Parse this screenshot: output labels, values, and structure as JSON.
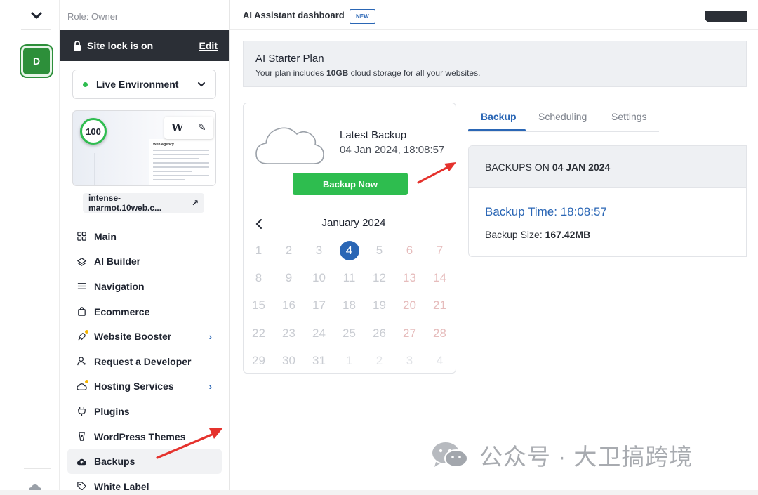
{
  "rail": {
    "avatar_letter": "D"
  },
  "sidebar": {
    "role": "Role: Owner",
    "site_lock": {
      "label": "Site lock is on",
      "edit": "Edit"
    },
    "environment": "Live Environment",
    "preview": {
      "score": "100",
      "site_heading": "Web Agency",
      "wp_glyph": "W",
      "edit_glyph": "✎"
    },
    "domain": {
      "label": "intense-marmot.10web.c...",
      "open_glyph": "↗"
    },
    "items": [
      {
        "label": "Main",
        "icon": "grid-icon",
        "more": ""
      },
      {
        "label": "AI Builder",
        "icon": "layers-icon",
        "more": ""
      },
      {
        "label": "Navigation",
        "icon": "menu-icon",
        "more": ""
      },
      {
        "label": "Ecommerce",
        "icon": "shopping-bag-icon",
        "more": ""
      },
      {
        "label": "Website Booster",
        "icon": "rocket-icon",
        "more": "›"
      },
      {
        "label": "Request a Developer",
        "icon": "developer-icon",
        "more": ""
      },
      {
        "label": "Hosting Services",
        "icon": "cloud-outline-icon",
        "more": "›"
      },
      {
        "label": "Plugins",
        "icon": "plug-icon",
        "more": ""
      },
      {
        "label": "WordPress Themes",
        "icon": "theme-icon",
        "more": ""
      },
      {
        "label": "Backups",
        "icon": "cloud-upload-icon",
        "more": ""
      },
      {
        "label": "White Label",
        "icon": "tag-icon",
        "more": ""
      }
    ]
  },
  "topbar": {
    "title": "AI Assistant dashboard",
    "new_tag": "NEW"
  },
  "plan": {
    "title": "AI Starter Plan",
    "desc_prefix": "Your plan includes ",
    "desc_bold": "10GB",
    "desc_suffix": " cloud storage for all your websites."
  },
  "backup_card": {
    "latest_label": "Latest Backup",
    "latest_date": "04 Jan 2024, 18:08:57",
    "backup_now": "Backup Now",
    "calendar": {
      "month": "January 2024",
      "prev_glyph": "<",
      "selected": "4",
      "weeks": [
        [
          "1",
          "2",
          "3",
          "4",
          "5",
          "6",
          "7"
        ],
        [
          "8",
          "9",
          "10",
          "11",
          "12",
          "13",
          "14"
        ],
        [
          "15",
          "16",
          "17",
          "18",
          "19",
          "20",
          "21"
        ],
        [
          "22",
          "23",
          "24",
          "25",
          "26",
          "27",
          "28"
        ],
        [
          "29",
          "30",
          "31",
          "1",
          "2",
          "3",
          "4"
        ]
      ]
    }
  },
  "tabs": [
    "Backup",
    "Scheduling",
    "Settings"
  ],
  "details": {
    "heading_prefix": "BACKUPS ON",
    "heading_date": "04 JAN 2024",
    "backup_time": "Backup Time: 18:08:57",
    "size_label": "Backup Size: ",
    "size_value": "167.42MB"
  },
  "watermark": "公众号 · 大卫搞跨境",
  "colors": {
    "accent": "#2a66b5",
    "success": "#2ebd4f",
    "dark": "#2b2f36",
    "arrow": "#e5322d"
  }
}
